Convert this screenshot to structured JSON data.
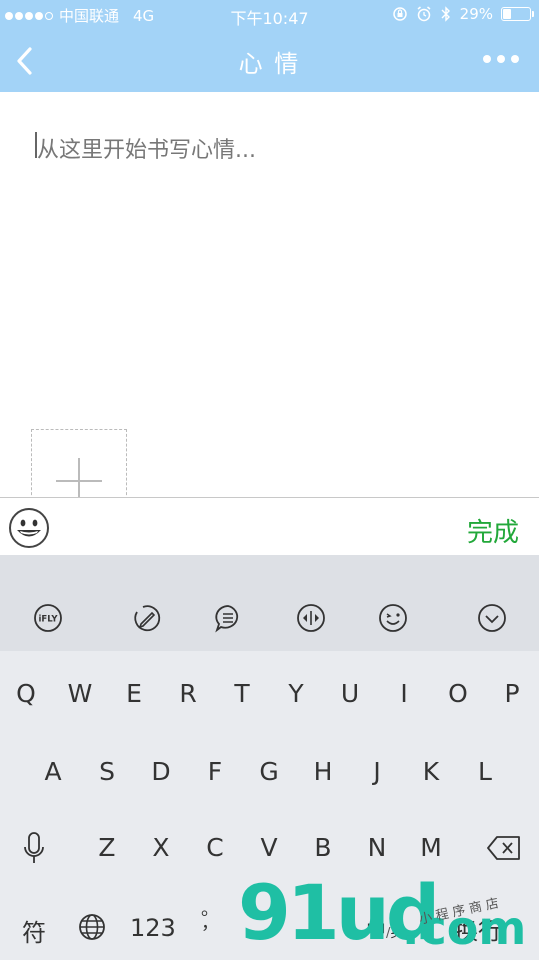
{
  "status_bar": {
    "carrier": "中国联通",
    "network": "4G",
    "time": "下午10:47",
    "battery_text": "29%",
    "battery_level": 0.29,
    "signal_bars": 4
  },
  "nav": {
    "title": "心 情"
  },
  "editor": {
    "placeholder": "从这里开始书写心情..."
  },
  "toolbar": {
    "done_label": "完成"
  },
  "keyboard": {
    "toolbar_icons": [
      "ifly-icon",
      "handwriting-icon",
      "message-icon",
      "cursor-move-icon",
      "emoji-face-icon",
      "collapse-keyboard-icon"
    ],
    "ifly_label": "iFLY",
    "row1": [
      "Q",
      "W",
      "E",
      "R",
      "T",
      "Y",
      "U",
      "I",
      "O",
      "P"
    ],
    "row2": [
      "A",
      "S",
      "D",
      "F",
      "G",
      "H",
      "J",
      "K",
      "L"
    ],
    "row3": [
      "Z",
      "X",
      "C",
      "V",
      "B",
      "N",
      "M"
    ],
    "symbol_label": "符",
    "number_label": "123",
    "comma_label": "，",
    "period_label": "。",
    "lang_cn": "中",
    "lang_en": "英",
    "enter_label": "换行"
  },
  "watermark": {
    "number": "91ud",
    "domain": ".com",
    "tagline": "小程序商店"
  },
  "colors": {
    "header": "#a3d3f7",
    "done": "#22a83a",
    "watermark": "#1fbfa4"
  }
}
